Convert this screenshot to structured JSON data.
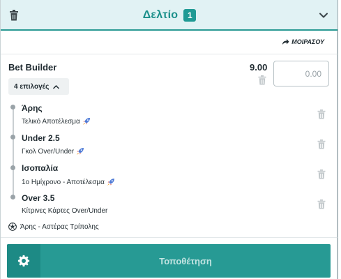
{
  "header": {
    "title": "Δελτίο",
    "count": "1"
  },
  "share_label": "ΜΟΙΡΑΣΟΥ",
  "bet": {
    "title": "Bet Builder",
    "odds": "9.00",
    "stake_placeholder": "0.00",
    "options_label": "4 επιλογές"
  },
  "selections": [
    {
      "pick": "Άρης",
      "market": "Τελικό Αποτέλεσμα"
    },
    {
      "pick": "Under 2.5",
      "market": "Γκολ Over/Under"
    },
    {
      "pick": "Ισοπαλία",
      "market": "1ο Ημίχρονο - Αποτέλεσμα"
    },
    {
      "pick": "Over 3.5",
      "market": "Κίτρινες Κάρτες Over/Under"
    }
  ],
  "match": "Άρης  -  Αστέρας Τρίπολης",
  "place_button_label": "Τοποθέτηση",
  "colors": {
    "accent": "#279a94",
    "header_bg": "#e1f2f4"
  },
  "icons": {
    "trash": "trash-icon",
    "chevron": "chevron-down-icon",
    "share": "share-arrow-icon",
    "rocket": "rocket-icon",
    "soccer": "soccer-ball-icon",
    "gear": "gear-icon"
  }
}
